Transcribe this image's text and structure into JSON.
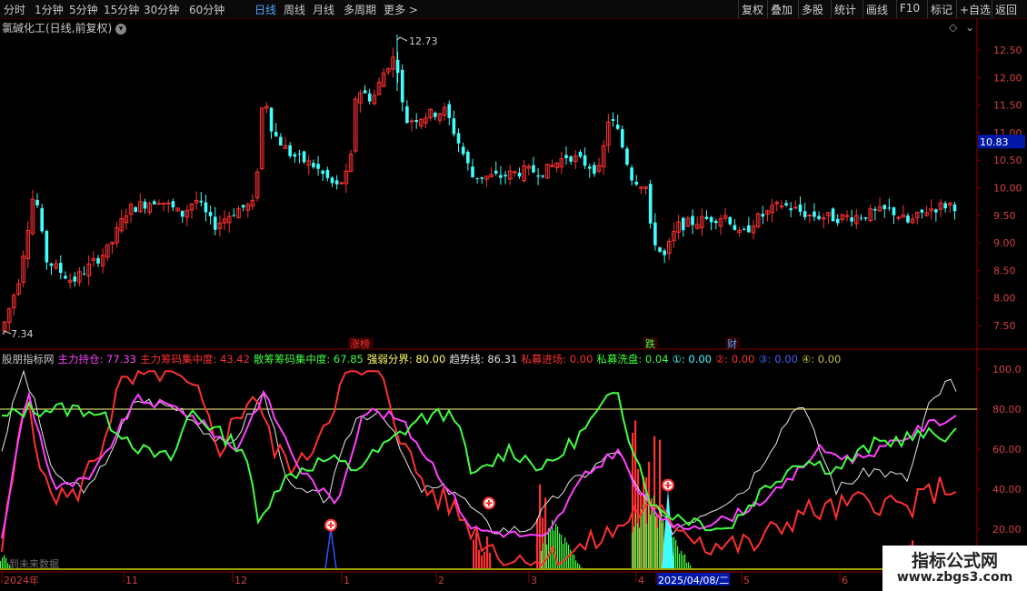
{
  "toolbar": {
    "periods": [
      "分时",
      "1分钟",
      "5分钟",
      "15分钟",
      "30分钟",
      "60分钟",
      "日线",
      "周线",
      "月线",
      "多周期",
      "更多 >"
    ],
    "active": "日线",
    "right": [
      "复权",
      "叠加",
      "多股",
      "统计",
      "画线",
      "F10",
      "标记",
      "+自选",
      "返回"
    ]
  },
  "stock": {
    "title": "氯碱化工(日线,前复权)"
  },
  "price_panel": {
    "yticks": [
      "12.50",
      "12.00",
      "11.50",
      "11.00",
      "10.50",
      "10.00",
      "9.50",
      "9.00",
      "8.50",
      "8.00",
      "7.50"
    ],
    "current_price": "10.83",
    "high_label": "12.73",
    "low_label": "7.34",
    "markers": [
      {
        "text": "涨榜",
        "color": "#ff3030"
      },
      {
        "text": "跌",
        "color": "#40ff40"
      },
      {
        "text": "财",
        "color": "#4fa3ff"
      }
    ]
  },
  "indicator": {
    "name": "股朋指标网",
    "legend": [
      {
        "text": "主力持仓: 77.33",
        "color": "#ff40ff"
      },
      {
        "text": "主力筹码集中度: 43.42",
        "color": "#ff3030"
      },
      {
        "text": "散筹筹码集中度: 67.85",
        "color": "#40ff40"
      },
      {
        "text": "强弱分界: 80.00",
        "color": "#ffff60"
      },
      {
        "text": "趋势线: 86.31",
        "color": "#e0e0e0"
      },
      {
        "text": "私募进场: 0.00",
        "color": "#ff3030"
      },
      {
        "text": "私募洗盘: 0.04",
        "color": "#40ff40"
      },
      {
        "text": "①: 0.00",
        "color": "#40ffff"
      },
      {
        "text": "②: 0.00",
        "color": "#ff3030"
      },
      {
        "text": "③: 0.00",
        "color": "#4060ff"
      },
      {
        "text": "④: 0.00",
        "color": "#c0c040"
      }
    ],
    "yticks": [
      "100.0",
      "80.00",
      "60.00",
      "40.00",
      "20.00"
    ],
    "future_note": "到未来数据"
  },
  "time_axis": {
    "labels": [
      "2024年",
      "11",
      "12",
      "1",
      "2",
      "3",
      "4",
      "2025/04/08/二",
      "5",
      "6"
    ]
  },
  "watermark": {
    "line1": "指标公式网",
    "line2": "www.zbgs3.com"
  },
  "colors": {
    "up": "#ff3030",
    "down": "#40ffff",
    "grid": "#8b0000",
    "magenta": "#ff40ff",
    "green": "#40ff40",
    "white": "#e8e8e8",
    "yellow": "#ffff80"
  }
}
